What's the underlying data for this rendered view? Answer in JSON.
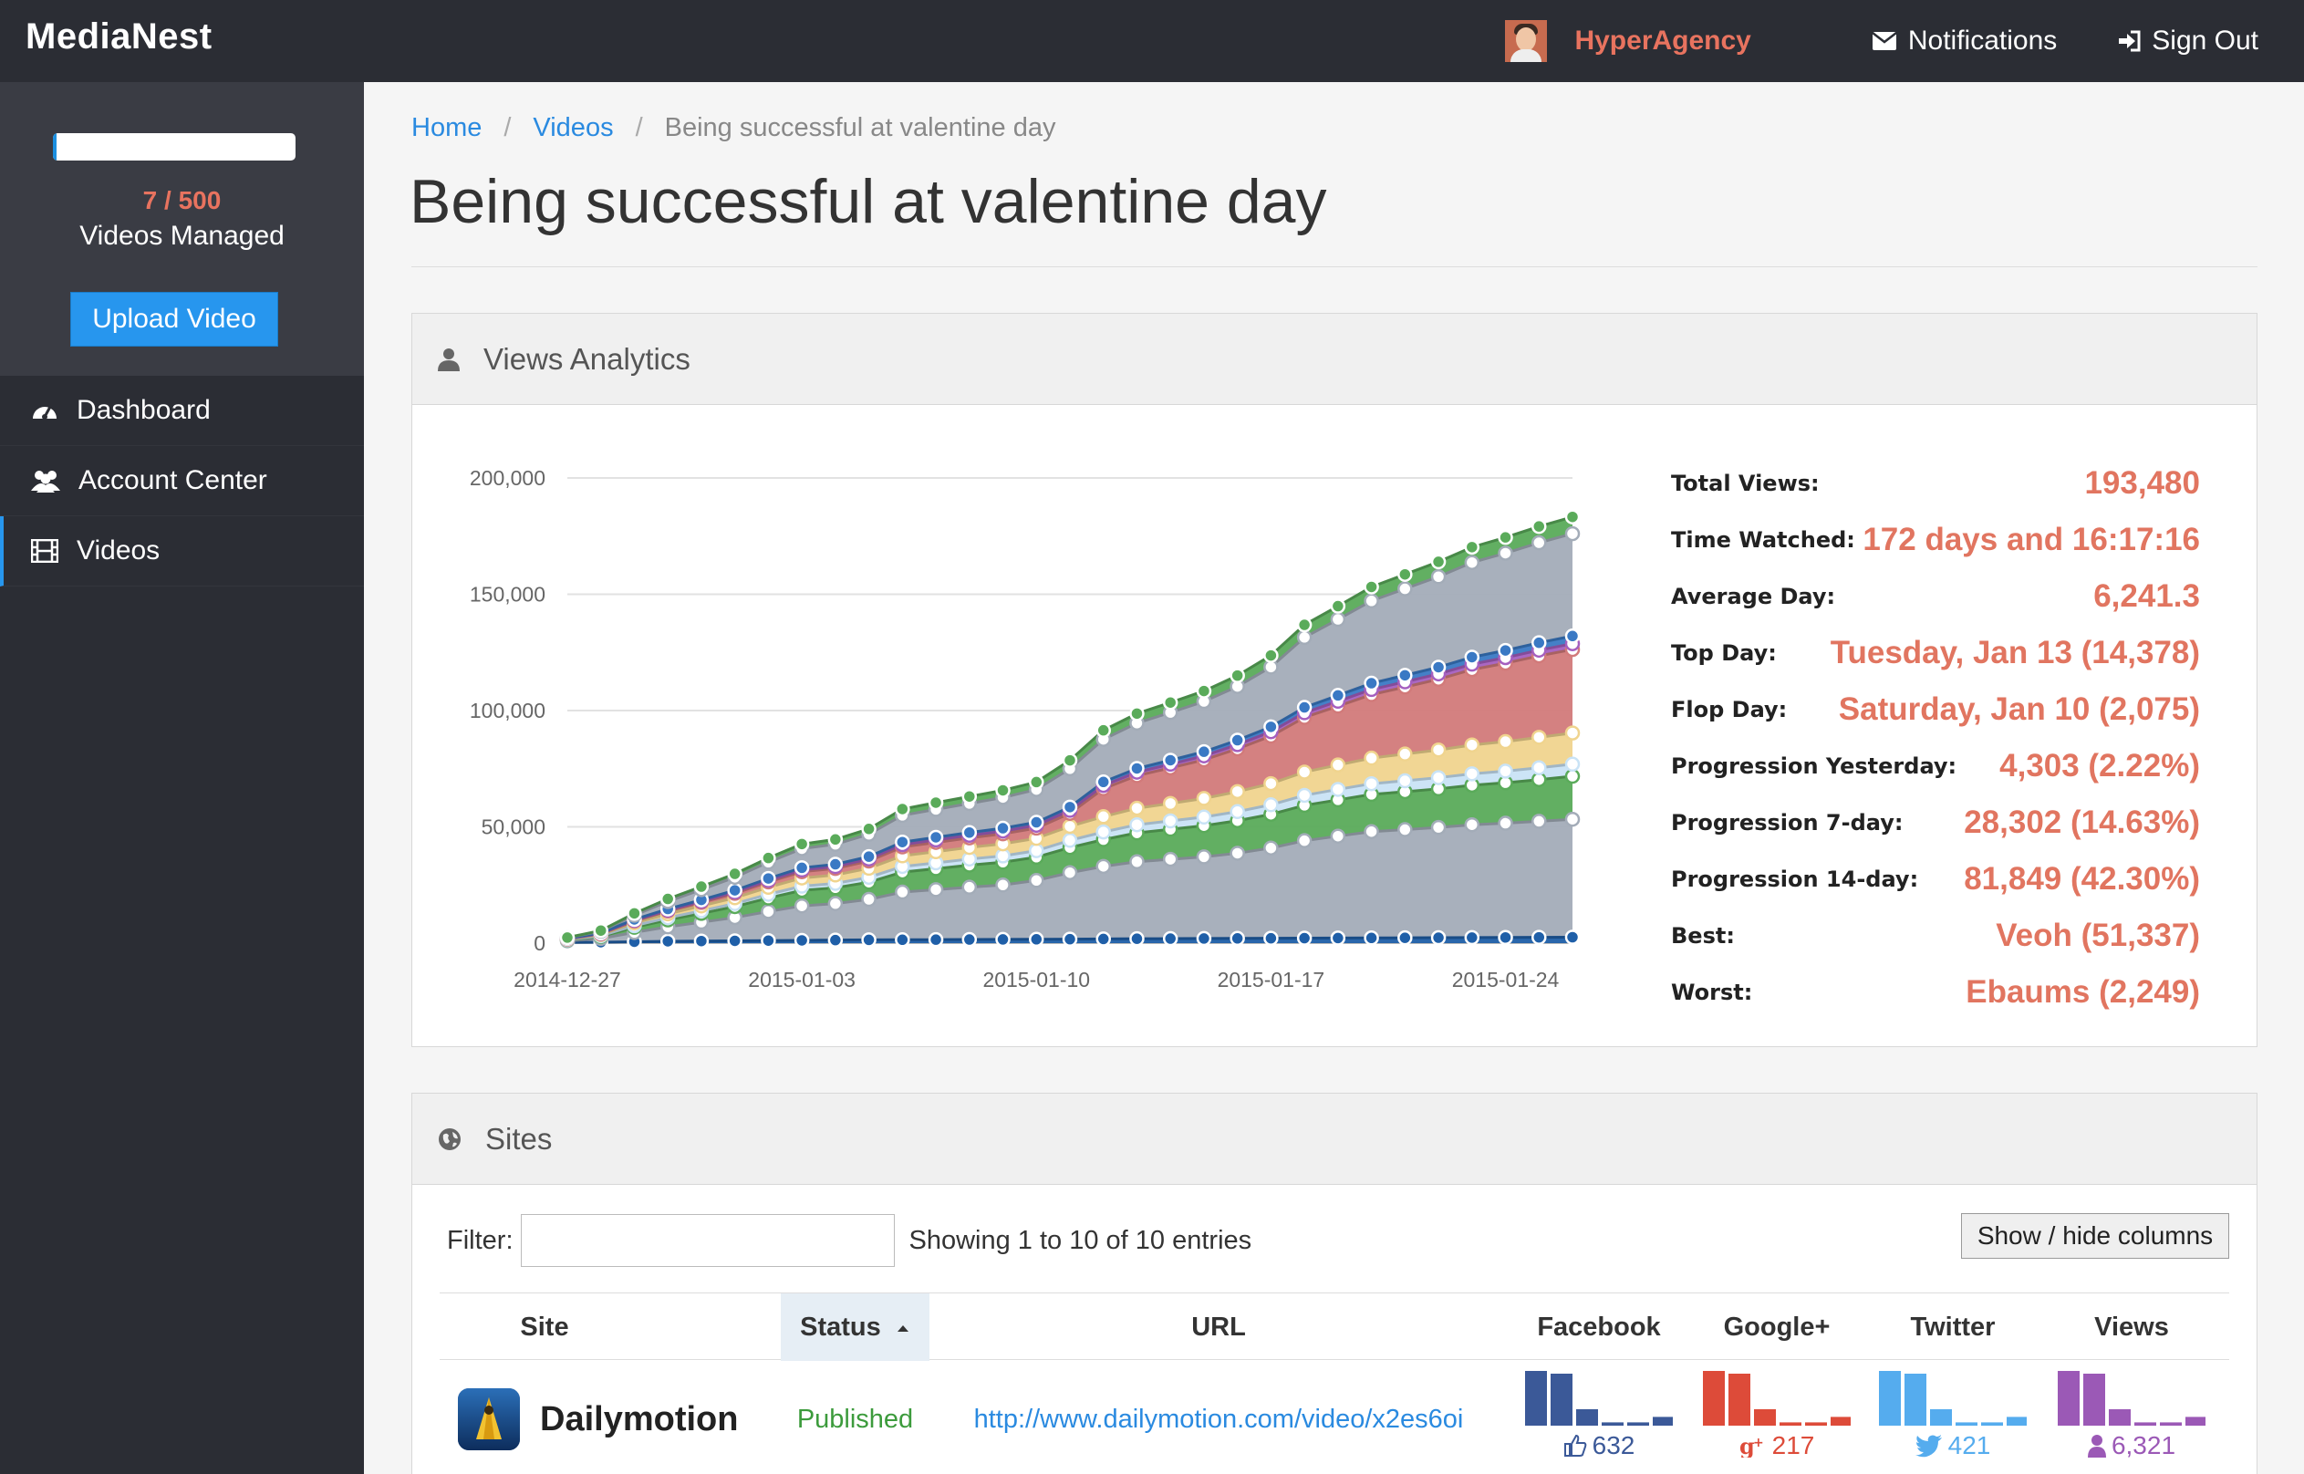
{
  "app": {
    "name": "MediaNest"
  },
  "topnav": {
    "user": "HyperAgency",
    "notifications": "Notifications",
    "signout": "Sign Out"
  },
  "sidebar": {
    "videos_count": "7 / 500",
    "videos_label": "Videos Managed",
    "quota_fraction": 0.014,
    "upload_label": "Upload Video",
    "items": [
      {
        "label": "Dashboard",
        "icon": "dashboard-icon"
      },
      {
        "label": "Account Center",
        "icon": "users-icon"
      },
      {
        "label": "Videos",
        "icon": "film-icon",
        "active": true
      }
    ]
  },
  "breadcrumb": {
    "home": "Home",
    "videos": "Videos",
    "current": "Being successful at valentine day"
  },
  "page": {
    "title": "Being successful at valentine day"
  },
  "analytics": {
    "title": "Views Analytics",
    "stats": [
      {
        "label": "Total Views:",
        "value": "193,480"
      },
      {
        "label": "Time Watched:",
        "value": "172 days and 16:17:16"
      },
      {
        "label": "Average Day:",
        "value": "6,241.3"
      },
      {
        "label": "Top Day:",
        "value": "Tuesday, Jan 13 (14,378)"
      },
      {
        "label": "Flop Day:",
        "value": "Saturday, Jan 10 (2,075)"
      },
      {
        "label": "Progression Yesterday:",
        "value": "4,303 (2.22%)"
      },
      {
        "label": "Progression 7-day:",
        "value": "28,302 (14.63%)"
      },
      {
        "label": "Progression 14-day:",
        "value": "81,849 (42.30%)"
      },
      {
        "label": "Best:",
        "value": "Veoh (51,337)"
      },
      {
        "label": "Worst:",
        "value": "Ebaums (2,249)"
      }
    ]
  },
  "chart_data": {
    "type": "area",
    "stacked": true,
    "x": [
      "2014-12-27",
      "2014-12-28",
      "2014-12-29",
      "2014-12-30",
      "2014-12-31",
      "2015-01-01",
      "2015-01-02",
      "2015-01-03",
      "2015-01-04",
      "2015-01-05",
      "2015-01-06",
      "2015-01-07",
      "2015-01-08",
      "2015-01-09",
      "2015-01-10",
      "2015-01-11",
      "2015-01-12",
      "2015-01-13",
      "2015-01-14",
      "2015-01-15",
      "2015-01-16",
      "2015-01-17",
      "2015-01-18",
      "2015-01-19",
      "2015-01-20",
      "2015-01-21",
      "2015-01-22",
      "2015-01-23",
      "2015-01-24",
      "2015-01-25",
      "2015-01-26"
    ],
    "xticks": [
      "2014-12-27",
      "2015-01-03",
      "2015-01-10",
      "2015-01-17",
      "2015-01-24"
    ],
    "yticks": [
      "0",
      "50,000",
      "100,000",
      "150,000",
      "200,000"
    ],
    "ylim": [
      0,
      200000
    ],
    "grid": true,
    "series": [
      {
        "color": "#1f5fa8",
        "values": [
          300,
          400,
          600,
          800,
          900,
          1000,
          1100,
          1200,
          1300,
          1400,
          1450,
          1500,
          1550,
          1600,
          1650,
          1700,
          1800,
          1900,
          1950,
          2000,
          2050,
          2100,
          2150,
          2200,
          2250,
          2300,
          2350,
          2400,
          2450,
          2500,
          2550
        ]
      },
      {
        "color": "#a3acb8",
        "values": [
          700,
          1600,
          4000,
          6200,
          8100,
          10000,
          12500,
          14800,
          15700,
          17400,
          20500,
          21500,
          22500,
          23400,
          25300,
          28600,
          31200,
          33100,
          34100,
          35100,
          36600,
          38800,
          41900,
          43800,
          45700,
          46500,
          47400,
          48500,
          49100,
          49900,
          50700
        ]
      },
      {
        "color": "#5aab5a",
        "values": [
          400,
          900,
          2200,
          3000,
          3800,
          4700,
          5800,
          6700,
          6800,
          7400,
          8600,
          9000,
          9500,
          9800,
          10000,
          10800,
          11500,
          12400,
          12900,
          13400,
          14000,
          14500,
          15200,
          15600,
          16000,
          16300,
          16600,
          17000,
          17400,
          17900,
          18500
        ]
      },
      {
        "color": "#c9e3f6",
        "values": [
          100,
          300,
          700,
          900,
          1100,
          1300,
          1600,
          1800,
          1900,
          2100,
          2400,
          2500,
          2600,
          2700,
          2800,
          3100,
          3300,
          3500,
          3600,
          3700,
          3900,
          4100,
          4300,
          4500,
          4600,
          4700,
          4800,
          4900,
          5000,
          5100,
          5200
        ]
      },
      {
        "color": "#f0d48e",
        "values": [
          200,
          500,
          1200,
          1700,
          2100,
          2500,
          3000,
          3500,
          3600,
          3900,
          4600,
          4800,
          5000,
          5200,
          5300,
          6000,
          6600,
          7100,
          7500,
          8000,
          8600,
          9100,
          10000,
          10500,
          11000,
          11500,
          11900,
          12400,
          12700,
          13100,
          13400
        ]
      },
      {
        "color": "#d27a7a",
        "values": [
          100,
          300,
          800,
          1200,
          1500,
          1900,
          2300,
          2700,
          2800,
          3100,
          3800,
          4000,
          4100,
          4300,
          4400,
          5600,
          12000,
          14000,
          15300,
          16600,
          18400,
          20400,
          23500,
          25300,
          27300,
          28800,
          30400,
          32400,
          33700,
          35000,
          35900
        ]
      },
      {
        "color": "#a55fbf",
        "values": [
          100,
          200,
          300,
          400,
          500,
          600,
          700,
          800,
          850,
          900,
          1000,
          1050,
          1100,
          1150,
          1200,
          1300,
          1400,
          1500,
          1600,
          1700,
          1800,
          1900,
          2000,
          2100,
          2200,
          2250,
          2300,
          2350,
          2400,
          2450,
          2500
        ]
      },
      {
        "color": "#3a79c4",
        "values": [
          100,
          200,
          400,
          500,
          600,
          700,
          800,
          900,
          950,
          1000,
          1100,
          1150,
          1200,
          1250,
          1300,
          1400,
          1500,
          1600,
          1700,
          1800,
          1900,
          2100,
          2300,
          2500,
          2700,
          2800,
          2900,
          3000,
          3100,
          3200,
          3300
        ]
      },
      {
        "color": "#a3acb8",
        "values": [
          300,
          700,
          1800,
          3200,
          4400,
          5600,
          7000,
          8200,
          8600,
          9600,
          11500,
          12000,
          12500,
          13200,
          14100,
          16500,
          18300,
          19500,
          20500,
          21600,
          23100,
          25700,
          30100,
          32700,
          35400,
          37200,
          38900,
          40700,
          41800,
          43000,
          44000
        ]
      },
      {
        "color": "#5aab5a",
        "values": [
          100,
          300,
          800,
          1100,
          1300,
          1500,
          1800,
          2000,
          2100,
          2300,
          2700,
          2900,
          3000,
          3100,
          3200,
          3600,
          3900,
          4100,
          4300,
          4500,
          4700,
          5000,
          5400,
          5700,
          6000,
          6200,
          6400,
          6600,
          6800,
          7000,
          7200
        ]
      }
    ]
  },
  "sites": {
    "title": "Sites",
    "filter_label": "Filter:",
    "filter_value": "",
    "info": "Showing 1 to 10 of 10 entries",
    "columns_button": "Show / hide columns",
    "columns": [
      "Site",
      "Status",
      "URL",
      "Facebook",
      "Google+",
      "Twitter",
      "Views"
    ],
    "rows": [
      {
        "site": "Dailymotion",
        "status": "Published",
        "url": "http://www.dailymotion.com/video/x2es6oi",
        "facebook": "632",
        "googleplus": "217",
        "twitter": "421",
        "views": "6,321"
      }
    ]
  },
  "colors": {
    "accent": "#e8735f",
    "link": "#2a8ae0",
    "primary": "#2796ee",
    "published": "#3c9b3c",
    "facebook": "#3b5998",
    "googleplus": "#dd4b39",
    "twitter": "#55acee",
    "views": "#9b59b6"
  }
}
